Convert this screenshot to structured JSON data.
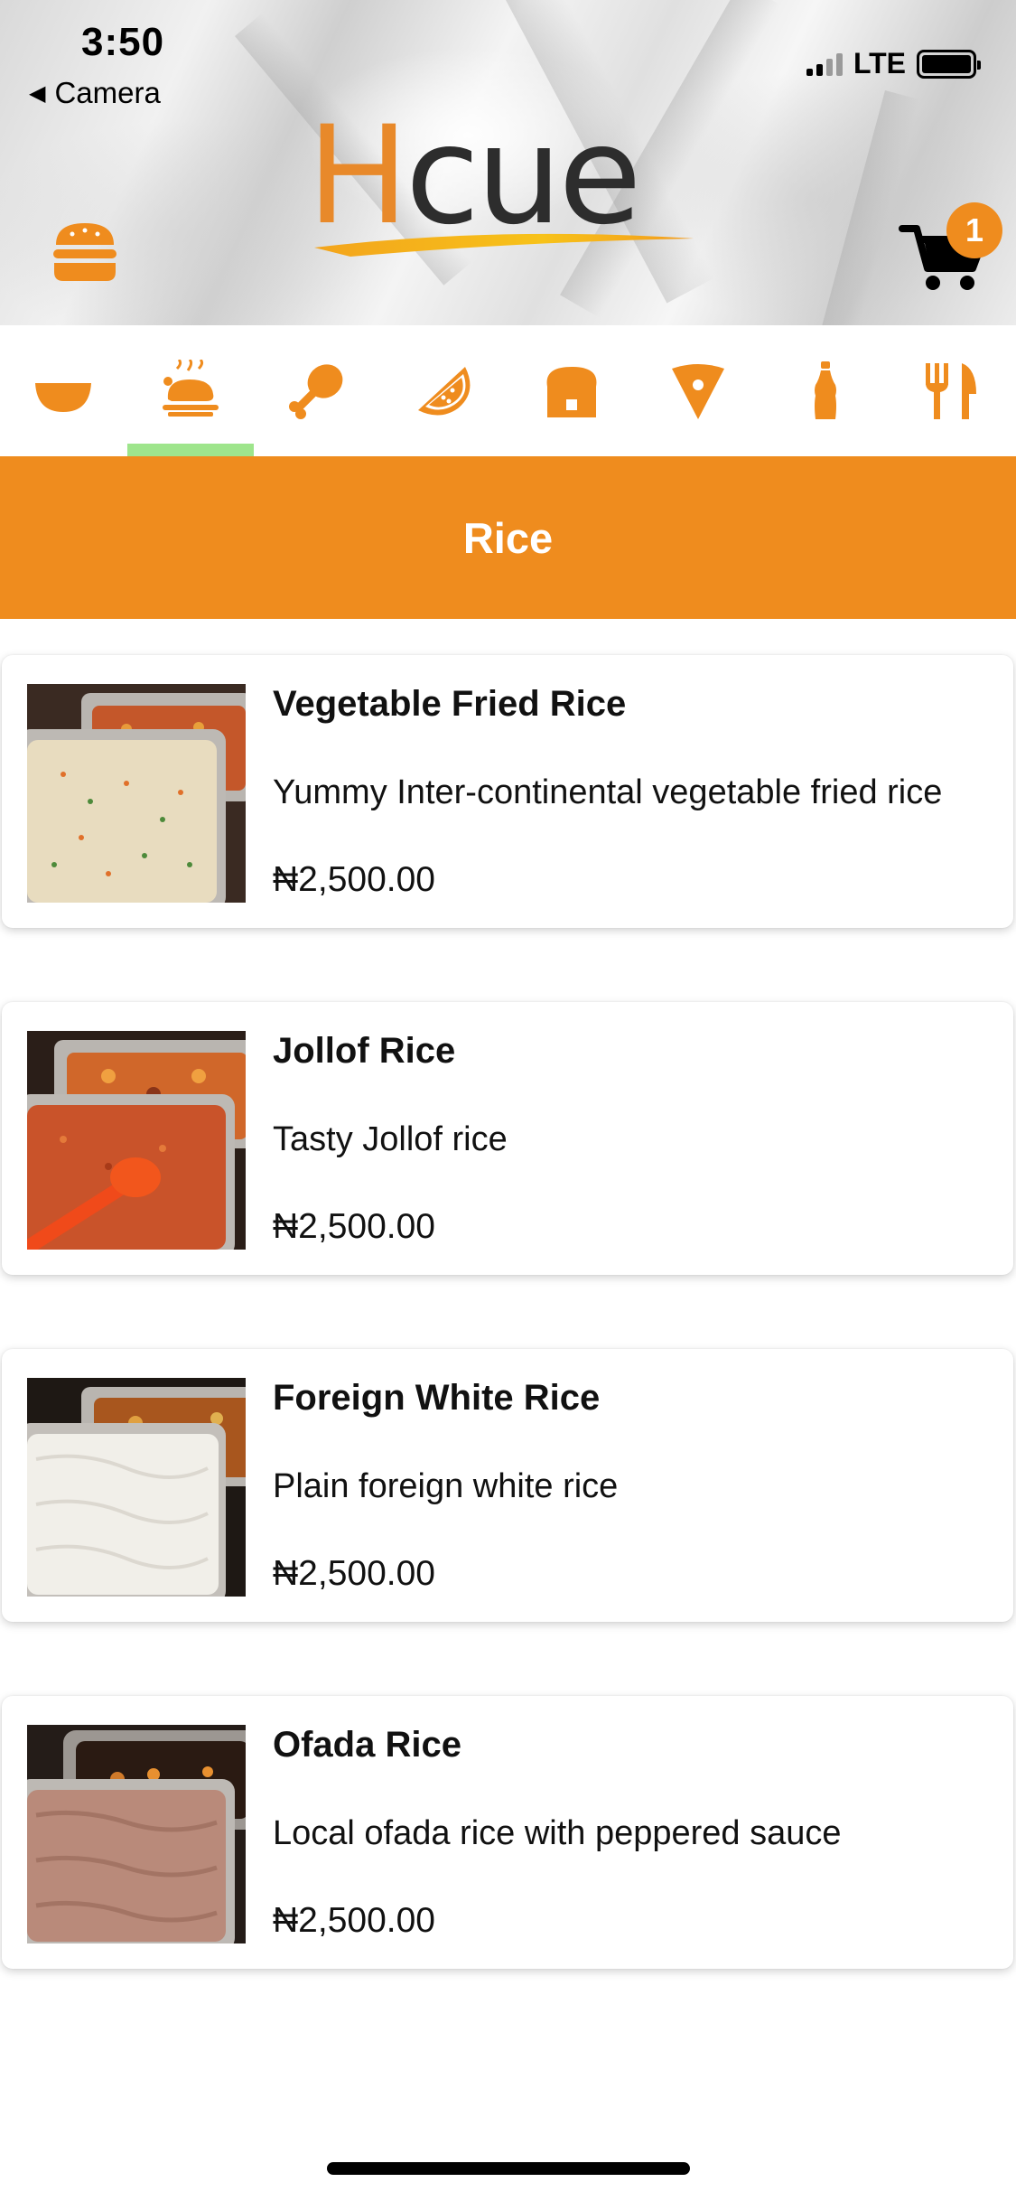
{
  "status_bar": {
    "time": "3:50",
    "back_label": "Camera",
    "network": "LTE"
  },
  "header": {
    "logo_first": "H",
    "logo_rest": "cue",
    "cart_count": "1"
  },
  "categories": [
    {
      "icon": "bowl-icon",
      "active": false
    },
    {
      "icon": "roast-chicken-icon",
      "active": true
    },
    {
      "icon": "chicken-leg-icon",
      "active": false
    },
    {
      "icon": "watermelon-icon",
      "active": false
    },
    {
      "icon": "bread-icon",
      "active": false
    },
    {
      "icon": "pizza-slice-icon",
      "active": false
    },
    {
      "icon": "bottle-icon",
      "active": false
    },
    {
      "icon": "fork-knife-icon",
      "active": false
    }
  ],
  "section": {
    "title": "Rice"
  },
  "products": [
    {
      "name": "Vegetable Fried Rice",
      "description": "Yummy Inter-continental vegetable fried rice",
      "price": "₦2,500.00"
    },
    {
      "name": "Jollof Rice",
      "description": "Tasty Jollof rice",
      "price": "₦2,500.00"
    },
    {
      "name": "Foreign White Rice",
      "description": "Plain foreign white rice",
      "price": "₦2,500.00"
    },
    {
      "name": "Ofada Rice",
      "description": "Local ofada rice with peppered sauce",
      "price": "₦2,500.00"
    }
  ],
  "colors": {
    "accent": "#ef8c1e",
    "active_tab_indicator": "#9ee58c",
    "text": "#111111"
  }
}
